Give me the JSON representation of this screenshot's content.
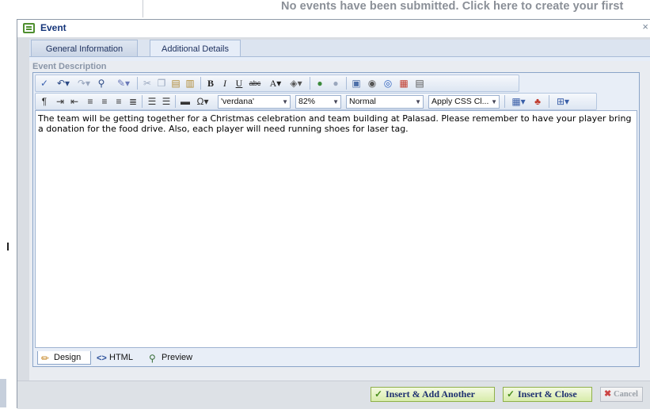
{
  "background": {
    "notice": "No events have been submitted.  Click here to create your first"
  },
  "dialog": {
    "title": "Event",
    "close": "×"
  },
  "tabs": [
    {
      "label": "General Information"
    },
    {
      "label": "Additional Details"
    }
  ],
  "editor": {
    "label": "Event Description",
    "content": "The team will be getting together for a Christmas celebration and team building at Palasad.  Please remember to have your player bring a donation for the food drive.  Also, each player will need running shoes for laser tag.",
    "font_name": "'verdana'",
    "font_size": "82%",
    "paragraph_style": "Normal",
    "css_class": "Apply CSS Cl...",
    "modes": [
      {
        "label": "Design"
      },
      {
        "label": "HTML"
      },
      {
        "label": "Preview"
      }
    ],
    "toolbar_icons": [
      "spellcheck-icon",
      "undo-icon",
      "redo-icon",
      "find-icon",
      "format-stripper-icon",
      "cut-icon",
      "copy-icon",
      "paste-icon",
      "paste-word-icon",
      "bold-icon",
      "italic-icon",
      "underline-icon",
      "strikethrough-icon",
      "font-color-icon",
      "back-color-icon",
      "hyperlink-icon",
      "remove-link-icon",
      "image-icon",
      "flash-icon",
      "media-icon",
      "document-icon",
      "template-icon",
      "paragraph-icon",
      "indent-icon",
      "outdent-icon",
      "align-left-icon",
      "align-center-icon",
      "align-right-icon",
      "justify-icon",
      "numbered-list-icon",
      "bulleted-list-icon",
      "horizontal-rule-icon",
      "symbol-icon",
      "table-icon",
      "format-painter-icon",
      "module-manager-icon"
    ]
  },
  "buttons": {
    "insert_add": "Insert & Add Another",
    "insert_close": "Insert & Close",
    "cancel": "Cancel"
  },
  "colors": {
    "title_text": "#15357a",
    "button_green": "#8fb04a",
    "tab_border": "#a9bcd8"
  }
}
